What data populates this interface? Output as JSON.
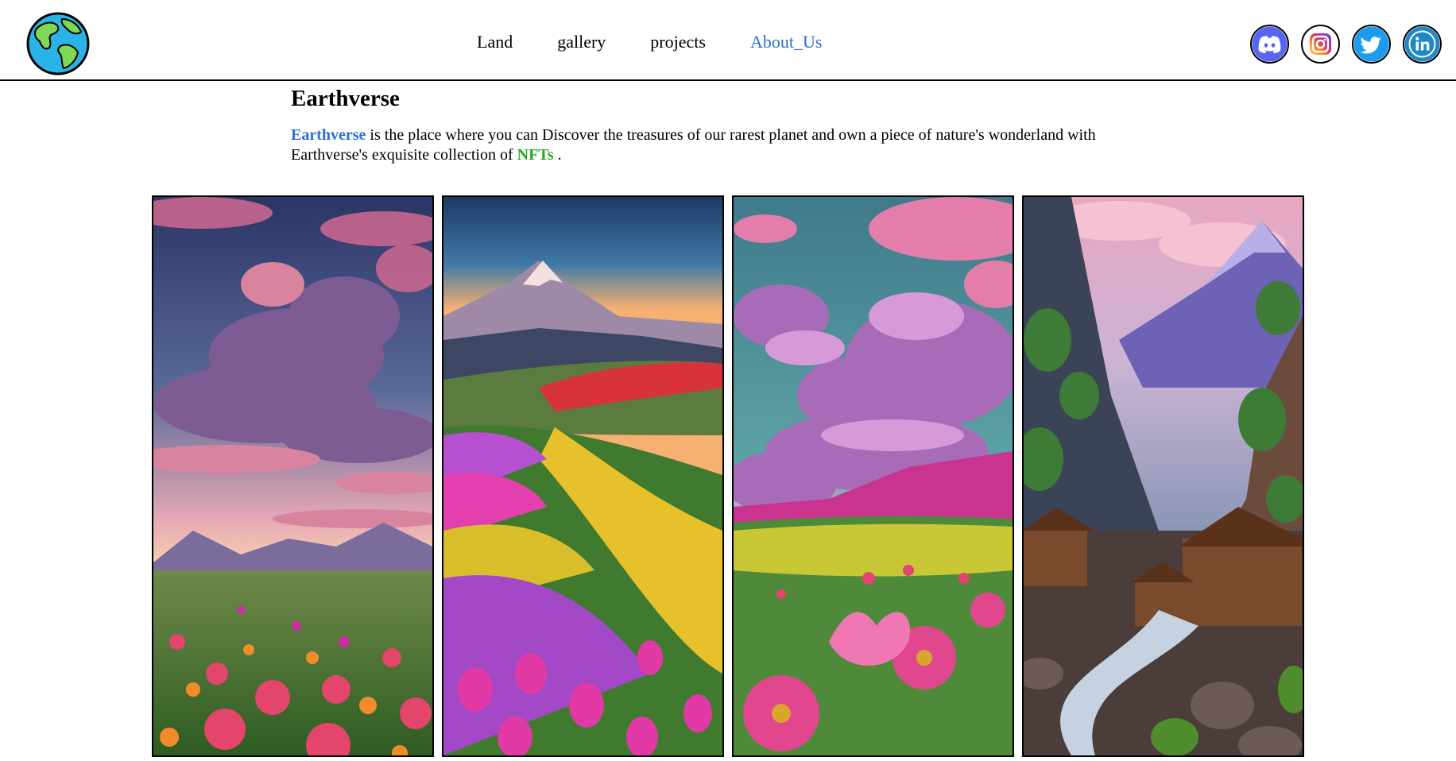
{
  "nav": {
    "logo_icon": "earth-globe-icon",
    "links": [
      {
        "label": "Land",
        "active": false
      },
      {
        "label": "gallery",
        "active": false
      },
      {
        "label": "projects",
        "active": false
      },
      {
        "label": "About_Us",
        "active": true
      }
    ],
    "socials": [
      {
        "icon": "discord-icon",
        "color": "#5865f2"
      },
      {
        "icon": "instagram-icon",
        "color": "#e1306c"
      },
      {
        "icon": "twitter-icon",
        "color": "#1d9bf0"
      },
      {
        "icon": "linkedin-icon",
        "color": "#1e88c8"
      }
    ]
  },
  "main": {
    "title": "Earthverse",
    "desc_brand": "Earthverse",
    "desc_middle": " is the place where you can Discover the treasures of our rarest planet and own a piece of nature's wonderland with Earthverse's exquisite collection of ",
    "desc_nft": "NFTs",
    "desc_end": " ."
  },
  "gallery": {
    "cards": [
      {
        "scene": "pink-clouds-flower-field"
      },
      {
        "scene": "mountain-tulip-field"
      },
      {
        "scene": "purple-clouds-daisy-field"
      },
      {
        "scene": "mountain-village-river"
      }
    ]
  },
  "colors": {
    "accent_blue": "#2b6fd8",
    "accent_green": "#22aa22"
  }
}
